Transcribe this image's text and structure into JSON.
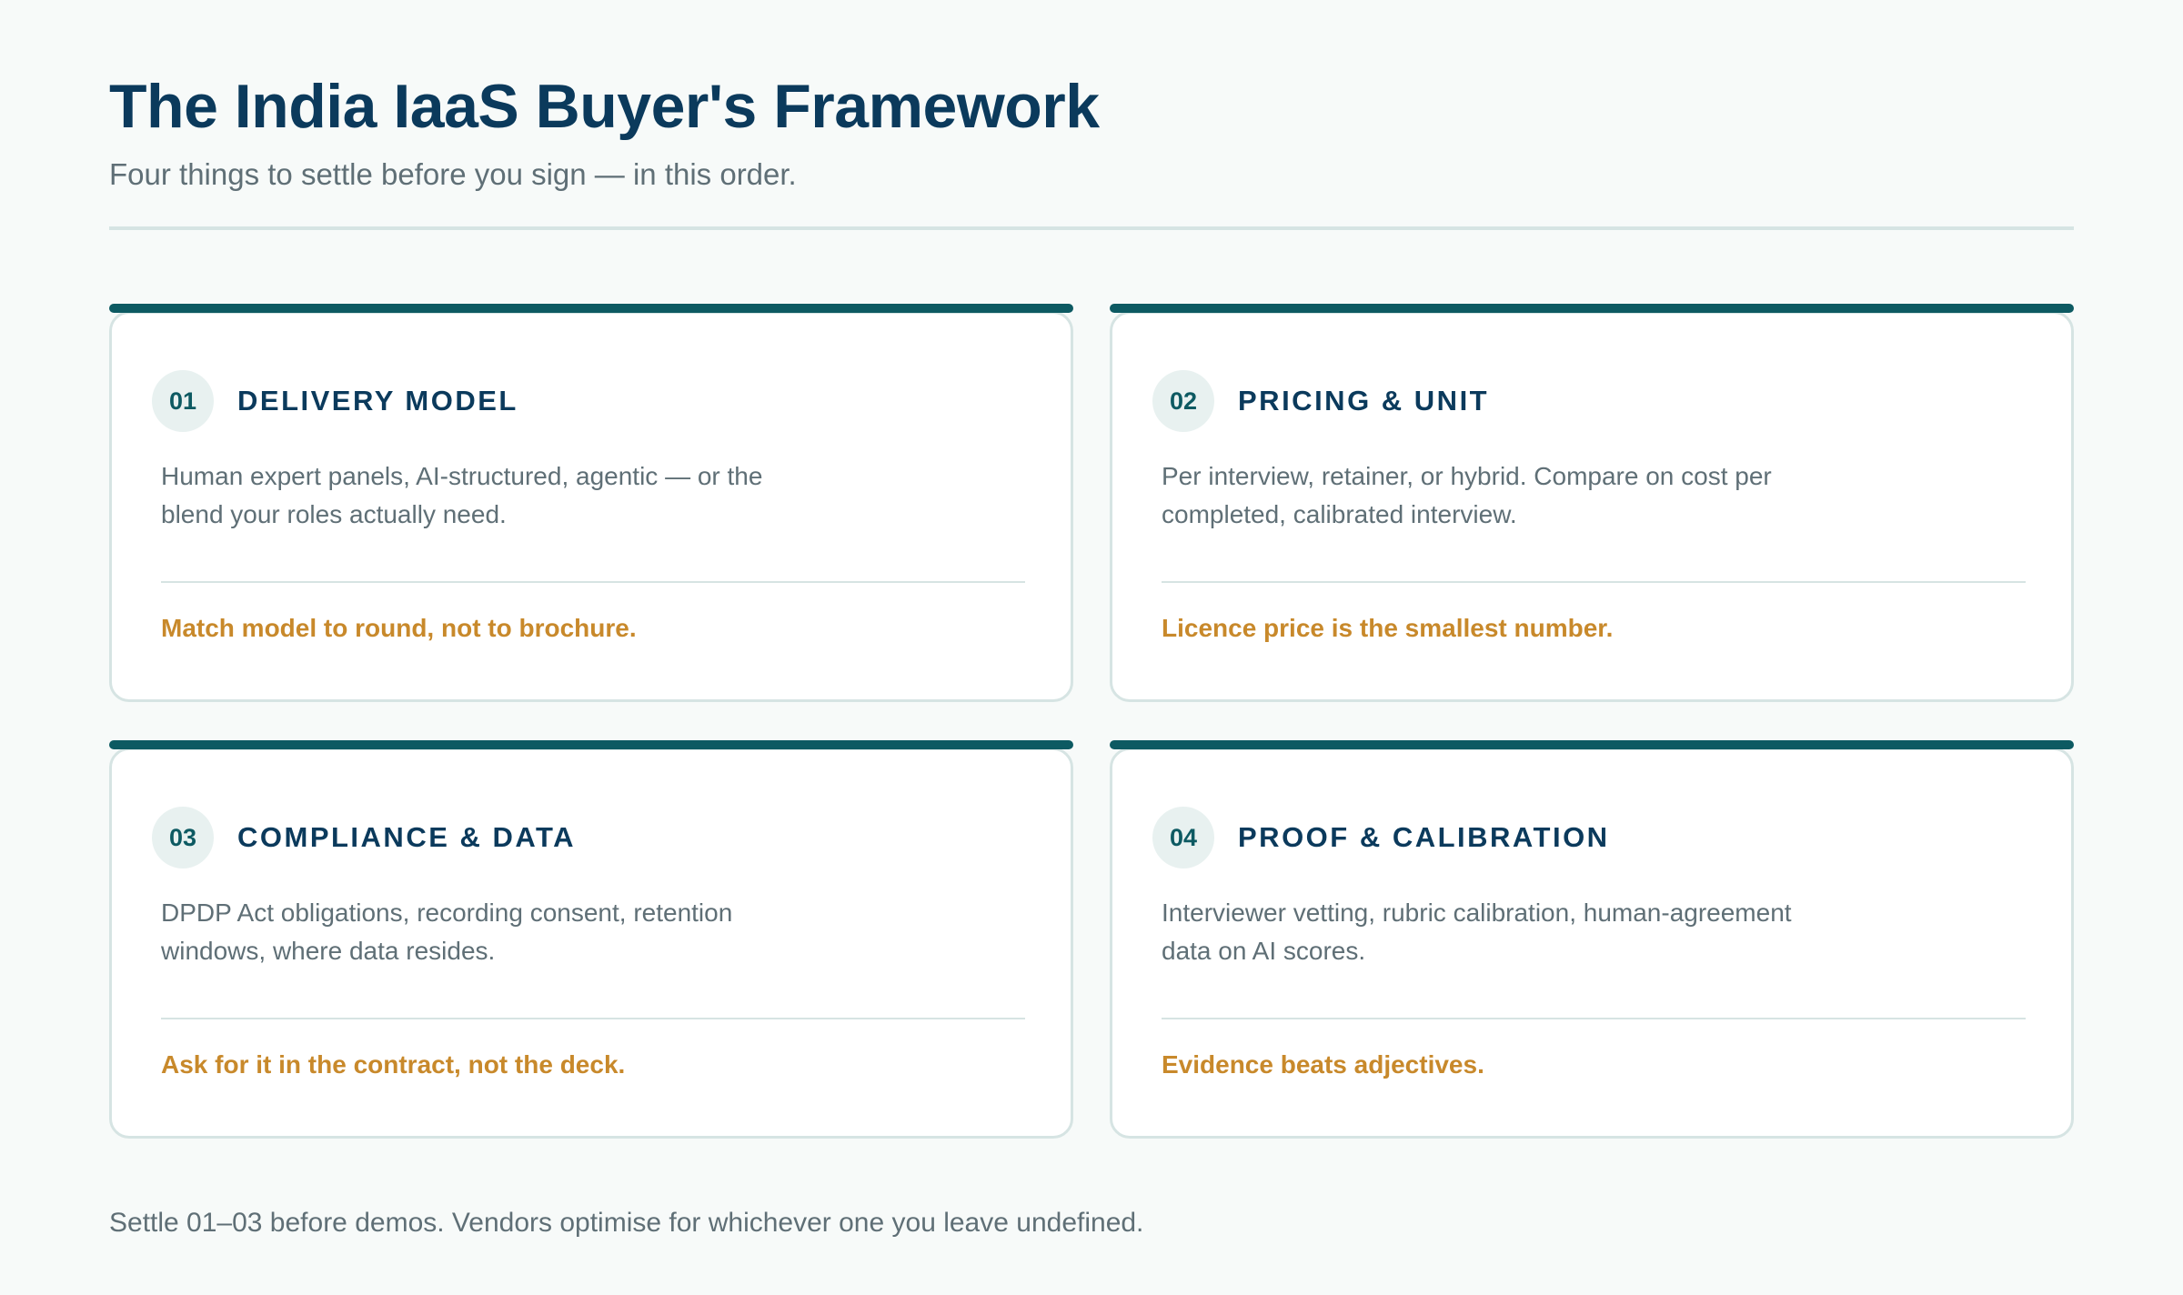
{
  "header": {
    "title": "The India IaaS Buyer's Framework",
    "subtitle": "Four things to settle before you sign — in this order."
  },
  "cards": [
    {
      "number": "01",
      "title": "DELIVERY MODEL",
      "body": "Human expert panels, AI-structured, agentic — or the blend your roles actually need.",
      "note": "Match model to round, not to brochure."
    },
    {
      "number": "02",
      "title": "PRICING & UNIT",
      "body": "Per interview, retainer, or hybrid. Compare on cost per completed, calibrated interview.",
      "note": "Licence price is the smallest number."
    },
    {
      "number": "03",
      "title": "COMPLIANCE & DATA",
      "body": "DPDP Act obligations, recording consent, retention windows, where data resides.",
      "note": "Ask for it in the contract, not the deck."
    },
    {
      "number": "04",
      "title": "PROOF & CALIBRATION",
      "body": "Interviewer vetting, rubric calibration, human-agreement data on AI scores.",
      "note": "Evidence beats adjectives."
    }
  ],
  "footer": {
    "text": "Settle 01–03 before demos. Vendors optimise for whichever one you leave undefined."
  },
  "colors": {
    "title": "#0b3a5c",
    "accent_bar": "#0d5a62",
    "note": "#c8892b",
    "body_text": "#5f6f76",
    "background": "#f7faf9"
  }
}
